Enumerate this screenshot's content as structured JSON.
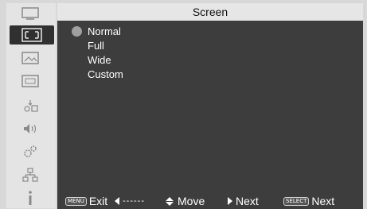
{
  "window": {
    "title": "Screen"
  },
  "sidebar": {
    "items": [
      {
        "icon": "display-icon",
        "active": false
      },
      {
        "icon": "screen-icon",
        "active": true
      },
      {
        "icon": "picture-icon",
        "active": false
      },
      {
        "icon": "image-adjust-icon",
        "active": false
      },
      {
        "icon": "setting-icon",
        "active": false
      },
      {
        "icon": "sound-icon",
        "active": false
      },
      {
        "icon": "gear-icon",
        "active": false
      },
      {
        "icon": "network-icon",
        "active": false
      },
      {
        "icon": "info-icon",
        "active": false
      }
    ]
  },
  "options": [
    {
      "label": "Normal",
      "selected": true
    },
    {
      "label": "Full",
      "selected": false
    },
    {
      "label": "Wide",
      "selected": false
    },
    {
      "label": "Custom",
      "selected": false
    }
  ],
  "help": {
    "menu_key": "MENU",
    "exit_label": "Exit",
    "dashes": "------",
    "move_label": "Move",
    "next_label": "Next",
    "select_key": "SELECT",
    "select_next_label": "Next"
  },
  "colors": {
    "panel": "#3d3d3d",
    "frame": "#d8d8d8",
    "active_tab": "#303030",
    "bullet": "#a0a0a0"
  }
}
